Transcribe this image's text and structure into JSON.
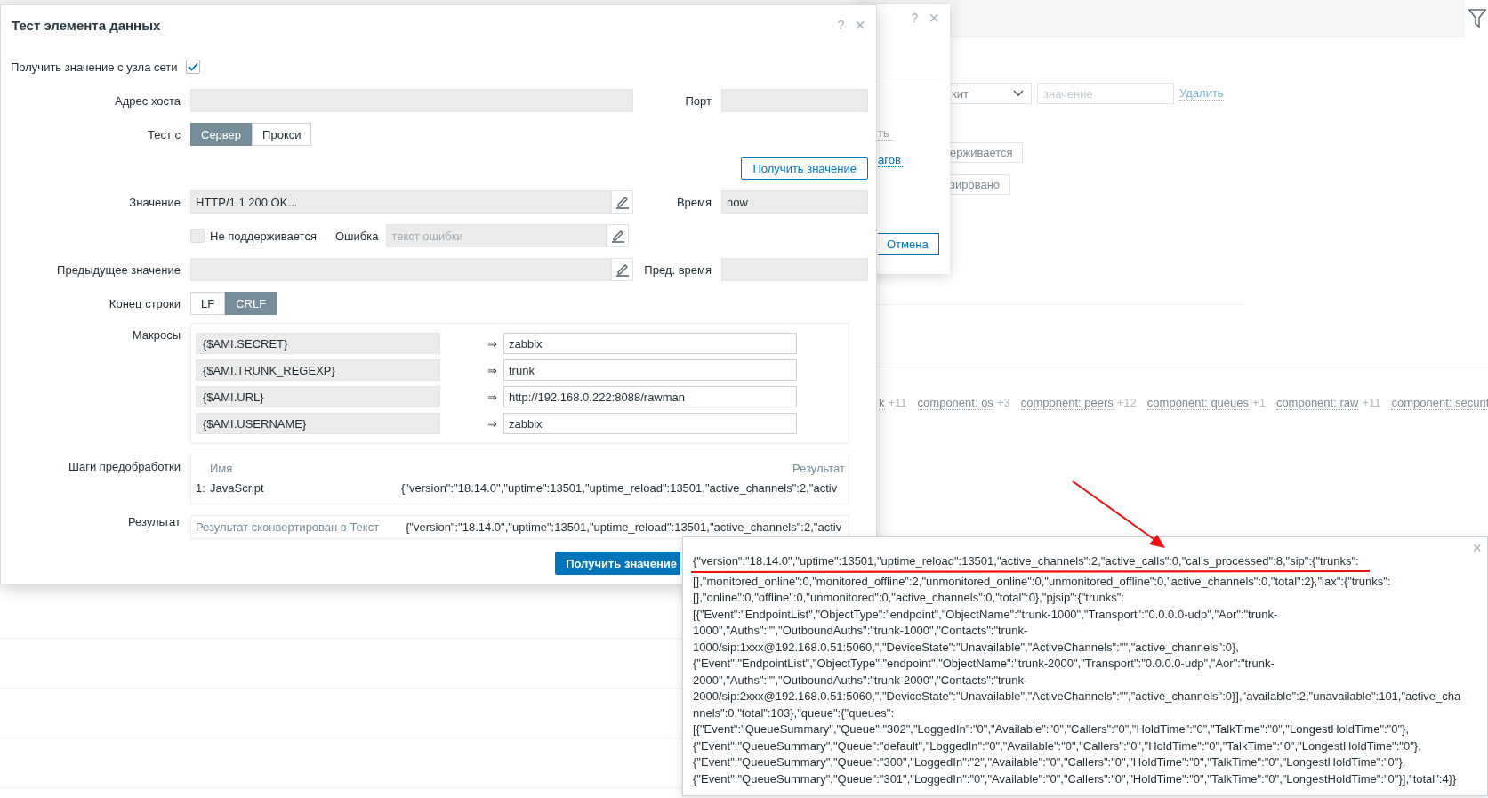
{
  "background": {
    "select_value": "кит",
    "value_placeholder": "значение",
    "remove_link": "Удалить",
    "buttons": [
      "ерживается",
      "зировано"
    ],
    "tags": [
      {
        "name": "k",
        "count": "+11"
      },
      {
        "name": "component: os",
        "count": "+3"
      },
      {
        "name": "component: peers",
        "count": "+12"
      },
      {
        "name": "component: queues",
        "count": "+1"
      },
      {
        "name": "component: raw",
        "count": "+11"
      },
      {
        "name": "component: securit"
      }
    ]
  },
  "back_dialog": {
    "help_icon": "?",
    "close_icon": "×",
    "disabled_link": "ть",
    "link": "агов",
    "cancel_button": "Отмена"
  },
  "dialog": {
    "title": "Тест элемента данных",
    "help_icon": "?",
    "close_icon": "×",
    "get_from_host": {
      "label": "Получить значение с узла сети",
      "checked": true
    },
    "host_address": {
      "label": "Адрес хоста"
    },
    "port": {
      "label": "Порт"
    },
    "test_with": {
      "label": "Тест с",
      "options": [
        {
          "label": "Сервер",
          "selected": true
        },
        {
          "label": "Прокси",
          "selected": false
        }
      ]
    },
    "get_value_button": "Получить значение",
    "value": {
      "label": "Значение",
      "value": "HTTP/1.1 200 OK..."
    },
    "time": {
      "label": "Время",
      "value": "now"
    },
    "not_supported": {
      "label": "Не поддерживается",
      "checked": false
    },
    "error": {
      "label": "Ошибка",
      "placeholder": "текст ошибки"
    },
    "previous_value": {
      "label": "Предыдущее значение"
    },
    "previous_time": {
      "label": "Пред. время"
    },
    "line_ending": {
      "label": "Конец строки",
      "options": [
        {
          "label": "LF",
          "selected": false
        },
        {
          "label": "CRLF",
          "selected": true
        }
      ]
    },
    "macros": {
      "label": "Макросы",
      "rows": [
        {
          "name": "{$AMI.SECRET}",
          "arrow": "⇒",
          "value": "zabbix"
        },
        {
          "name": "{$AMI.TRUNK_REGEXP}",
          "arrow": "⇒",
          "value": "trunk"
        },
        {
          "name": "{$AMI.URL}",
          "arrow": "⇒",
          "value": "http://192.168.0.222:8088/rawman"
        },
        {
          "name": "{$AMI.USERNAME}",
          "arrow": "⇒",
          "value": "zabbix"
        }
      ]
    },
    "preprocessing": {
      "label": "Шаги предобработки",
      "columns": [
        "Имя",
        "Результат"
      ],
      "rows": [
        {
          "index": "1:",
          "name": "JavaScript",
          "result": "{\"version\":\"18.14.0\",\"uptime\":13501,\"uptime_reload\":13501,\"active_channels\":2,\"activ"
        }
      ]
    },
    "result": {
      "label": "Результат",
      "note": "Результат сконвертирован в Текст",
      "value": "{\"version\":\"18.14.0\",\"uptime\":13501,\"uptime_reload\":13501,\"active_channels\":2,\"activ"
    },
    "submit_button": "Получить значение"
  },
  "popup": {
    "close_icon": "×",
    "lines": [
      "{\"version\":\"18.14.0\",\"uptime\":13501,\"uptime_reload\":13501,\"active_channels\":2,\"active_calls\":0,\"calls_processed\":8,\"sip\":{\"trunks\":",
      "[],\"monitored_online\":0,\"monitored_offline\":2,\"unmonitored_online\":0,\"unmonitored_offline\":0,\"active_channels\":0,\"total\":2},\"iax\":{\"trunks\":",
      "[],\"online\":0,\"offline\":0,\"unmonitored\":0,\"active_channels\":0,\"total\":0},\"pjsip\":{\"trunks\":",
      "[{\"Event\":\"EndpointList\",\"ObjectType\":\"endpoint\",\"ObjectName\":\"trunk-1000\",\"Transport\":\"0.0.0.0-udp\",\"Aor\":\"trunk-",
      "1000\",\"Auths\":\"\",\"OutboundAuths\":\"trunk-1000\",\"Contacts\":\"trunk-",
      "1000/sip:1xxx@192.168.0.51:5060,\",\"DeviceState\":\"Unavailable\",\"ActiveChannels\":\"\",\"active_channels\":0},",
      "{\"Event\":\"EndpointList\",\"ObjectType\":\"endpoint\",\"ObjectName\":\"trunk-2000\",\"Transport\":\"0.0.0.0-udp\",\"Aor\":\"trunk-",
      "2000\",\"Auths\":\"\",\"OutboundAuths\":\"trunk-2000\",\"Contacts\":\"trunk-",
      "2000/sip:2xxx@192.168.0.51:5060,\",\"DeviceState\":\"Unavailable\",\"ActiveChannels\":\"\",\"active_channels\":0}],\"available\":2,\"unavailable\":101,\"active_cha",
      "nnels\":0,\"total\":103},\"queue\":{\"queues\":",
      "[{\"Event\":\"QueueSummary\",\"Queue\":\"302\",\"LoggedIn\":\"0\",\"Available\":\"0\",\"Callers\":\"0\",\"HoldTime\":\"0\",\"TalkTime\":\"0\",\"LongestHoldTime\":\"0\"},",
      "{\"Event\":\"QueueSummary\",\"Queue\":\"default\",\"LoggedIn\":\"0\",\"Available\":\"0\",\"Callers\":\"0\",\"HoldTime\":\"0\",\"TalkTime\":\"0\",\"LongestHoldTime\":\"0\"},",
      "{\"Event\":\"QueueSummary\",\"Queue\":\"300\",\"LoggedIn\":\"2\",\"Available\":\"0\",\"Callers\":\"0\",\"HoldTime\":\"0\",\"TalkTime\":\"0\",\"LongestHoldTime\":\"0\"},",
      "{\"Event\":\"QueueSummary\",\"Queue\":\"301\",\"LoggedIn\":\"0\",\"Available\":\"0\",\"Callers\":\"0\",\"HoldTime\":\"0\",\"TalkTime\":\"0\",\"LongestHoldTime\":\"0\"}],\"total\":4}}"
    ]
  }
}
